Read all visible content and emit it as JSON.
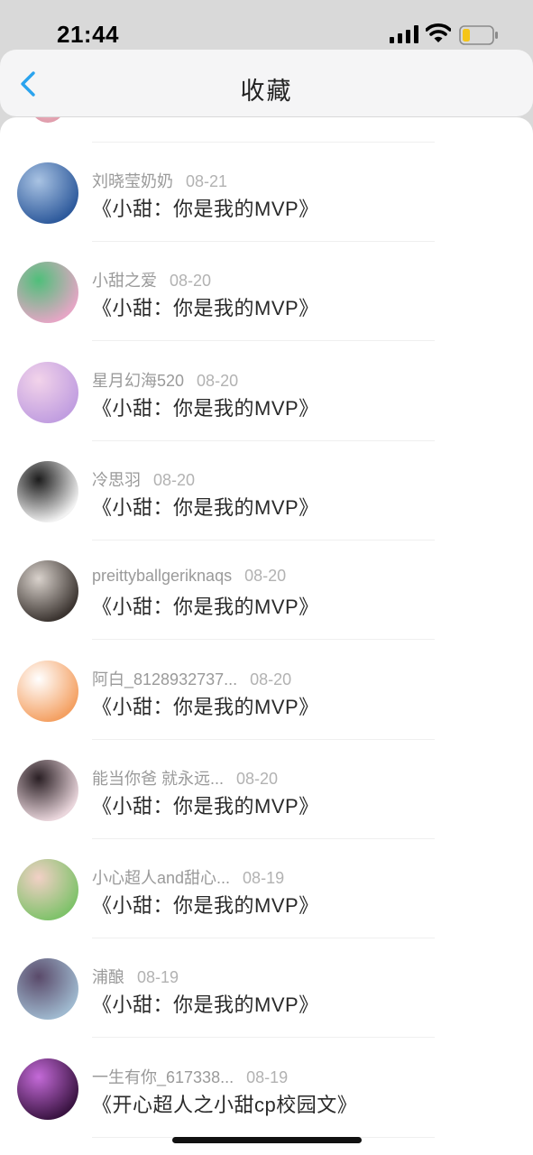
{
  "status_bar": {
    "time": "21:44",
    "battery_color": "#f5c518"
  },
  "nav": {
    "back_icon": "chevron-left-icon",
    "title": "收藏",
    "accent_color": "#2aa3ee"
  },
  "items": [
    {
      "username": "刘晓莹奶奶",
      "date": "08-21",
      "title": "《小甜：你是我的MVP》",
      "avatar_colors": [
        "#2e5a9c",
        "#a9c3e3"
      ]
    },
    {
      "username": "小甜之爱",
      "date": "08-20",
      "title": "《小甜：你是我的MVP》",
      "avatar_colors": [
        "#e5a6c5",
        "#4fbf7a"
      ]
    },
    {
      "username": "星月幻海520",
      "date": "08-20",
      "title": "《小甜：你是我的MVP》",
      "avatar_colors": [
        "#c19ee0",
        "#f2d3ea"
      ]
    },
    {
      "username": "冷思羽",
      "date": "08-20",
      "title": "《小甜：你是我的MVP》",
      "avatar_colors": [
        "#f2f2f2",
        "#1c1c1c"
      ]
    },
    {
      "username": "preittyballgeriknaqs",
      "date": "08-20",
      "title": "《小甜：你是我的MVP》",
      "avatar_colors": [
        "#3b3430",
        "#d9d2cc"
      ]
    },
    {
      "username": "阿白_8128932737...",
      "date": "08-20",
      "title": "《小甜：你是我的MVP》",
      "avatar_colors": [
        "#f4a062",
        "#ffffff"
      ]
    },
    {
      "username": "能当你爸 就永远...",
      "date": "08-20",
      "title": "《小甜：你是我的MVP》",
      "avatar_colors": [
        "#ead6dc",
        "#2a1f24"
      ]
    },
    {
      "username": "小心超人and甜心...",
      "date": "08-19",
      "title": "《小甜：你是我的MVP》",
      "avatar_colors": [
        "#7fc26a",
        "#f2d0c6"
      ]
    },
    {
      "username": "浦酿",
      "date": "08-19",
      "title": "《小甜：你是我的MVP》",
      "avatar_colors": [
        "#9fb9cf",
        "#5a4a6a"
      ]
    },
    {
      "username": "一生有你_617338...",
      "date": "08-19",
      "title": "《开心超人之小甜cp校园文》",
      "avatar_colors": [
        "#3a1442",
        "#c46ad8"
      ]
    }
  ]
}
